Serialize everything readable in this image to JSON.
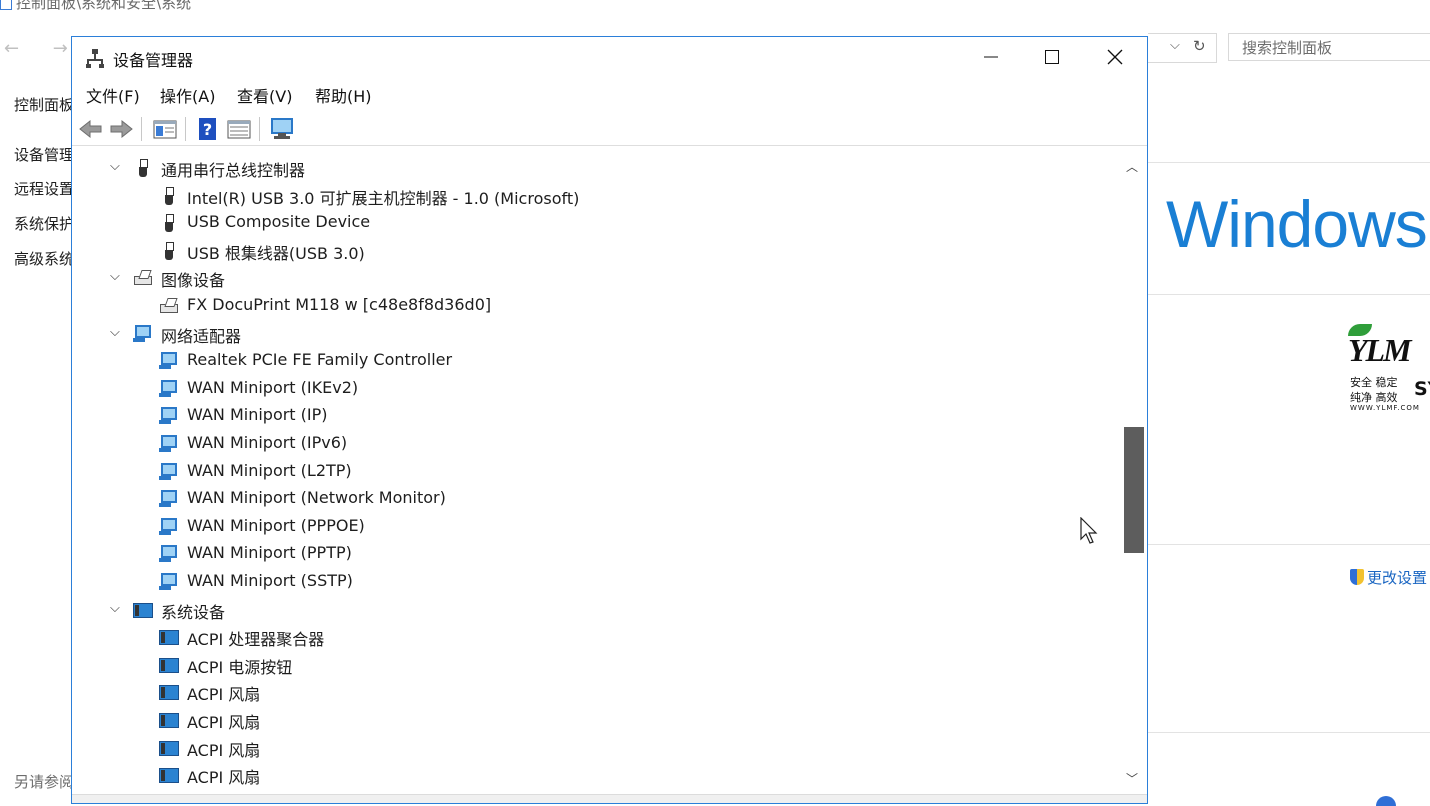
{
  "background_window": {
    "breadcrumb": "控制面板\\系统和安全\\系统",
    "nav_arrows": "← →",
    "search_placeholder": "搜索控制面板",
    "sidebar_links": [
      "控制面板主页",
      "设备管理器",
      "远程设置",
      "系统保护",
      "高级系统设置"
    ],
    "see_also": "另请参阅",
    "windows_logo_text": "Windows",
    "brand_logo": {
      "letters": "YLM",
      "line1": "安全 稳定",
      "line2": "纯净 高效",
      "sy": "SY",
      "url": "WWW.YLMF.COM"
    },
    "change_settings": "更改设置",
    "accent_color": "#1a7fd4"
  },
  "window": {
    "title": "设备管理器",
    "caption_buttons": [
      "minimize",
      "maximize",
      "close"
    ],
    "menus": [
      {
        "label": "文件(F)"
      },
      {
        "label": "操作(A)"
      },
      {
        "label": "查看(V)"
      },
      {
        "label": "帮助(H)"
      }
    ],
    "toolbar_icons": [
      "back-arrow-icon",
      "forward-arrow-icon",
      "properties-icon",
      "help-icon",
      "view-icon",
      "scan-hardware-icon"
    ],
    "border_color": "#2b7fd9"
  },
  "tree": [
    {
      "type": "category",
      "label": "通用串行总线控制器",
      "icon": "usb-icon",
      "expanded": true
    },
    {
      "type": "device",
      "label": "Intel(R) USB 3.0 可扩展主机控制器 - 1.0 (Microsoft)",
      "icon": "usb-icon"
    },
    {
      "type": "device",
      "label": "USB Composite Device",
      "icon": "usb-icon"
    },
    {
      "type": "device",
      "label": "USB 根集线器(USB 3.0)",
      "icon": "usb-icon"
    },
    {
      "type": "category",
      "label": "图像设备",
      "icon": "imaging-icon",
      "expanded": true
    },
    {
      "type": "device",
      "label": "FX DocuPrint M118 w [c48e8f8d36d0]",
      "icon": "imaging-icon"
    },
    {
      "type": "category",
      "label": "网络适配器",
      "icon": "network-icon",
      "expanded": true
    },
    {
      "type": "device",
      "label": "Realtek PCIe FE Family Controller",
      "icon": "network-icon"
    },
    {
      "type": "device",
      "label": "WAN Miniport (IKEv2)",
      "icon": "network-icon"
    },
    {
      "type": "device",
      "label": "WAN Miniport (IP)",
      "icon": "network-icon"
    },
    {
      "type": "device",
      "label": "WAN Miniport (IPv6)",
      "icon": "network-icon"
    },
    {
      "type": "device",
      "label": "WAN Miniport (L2TP)",
      "icon": "network-icon"
    },
    {
      "type": "device",
      "label": "WAN Miniport (Network Monitor)",
      "icon": "network-icon"
    },
    {
      "type": "device",
      "label": "WAN Miniport (PPPOE)",
      "icon": "network-icon"
    },
    {
      "type": "device",
      "label": "WAN Miniport (PPTP)",
      "icon": "network-icon"
    },
    {
      "type": "device",
      "label": "WAN Miniport (SSTP)",
      "icon": "network-icon"
    },
    {
      "type": "category",
      "label": "系统设备",
      "icon": "system-device-icon",
      "expanded": true
    },
    {
      "type": "device",
      "label": "ACPI 处理器聚合器",
      "icon": "system-device-icon"
    },
    {
      "type": "device",
      "label": "ACPI 电源按钮",
      "icon": "system-device-icon"
    },
    {
      "type": "device",
      "label": "ACPI 风扇",
      "icon": "system-device-icon"
    },
    {
      "type": "device",
      "label": "ACPI 风扇",
      "icon": "system-device-icon"
    },
    {
      "type": "device",
      "label": "ACPI 风扇",
      "icon": "system-device-icon"
    },
    {
      "type": "device",
      "label": "ACPI 风扇",
      "icon": "system-device-icon"
    }
  ],
  "scrollbar": {
    "position_fraction": 0.55,
    "visible_fraction": 0.2
  }
}
